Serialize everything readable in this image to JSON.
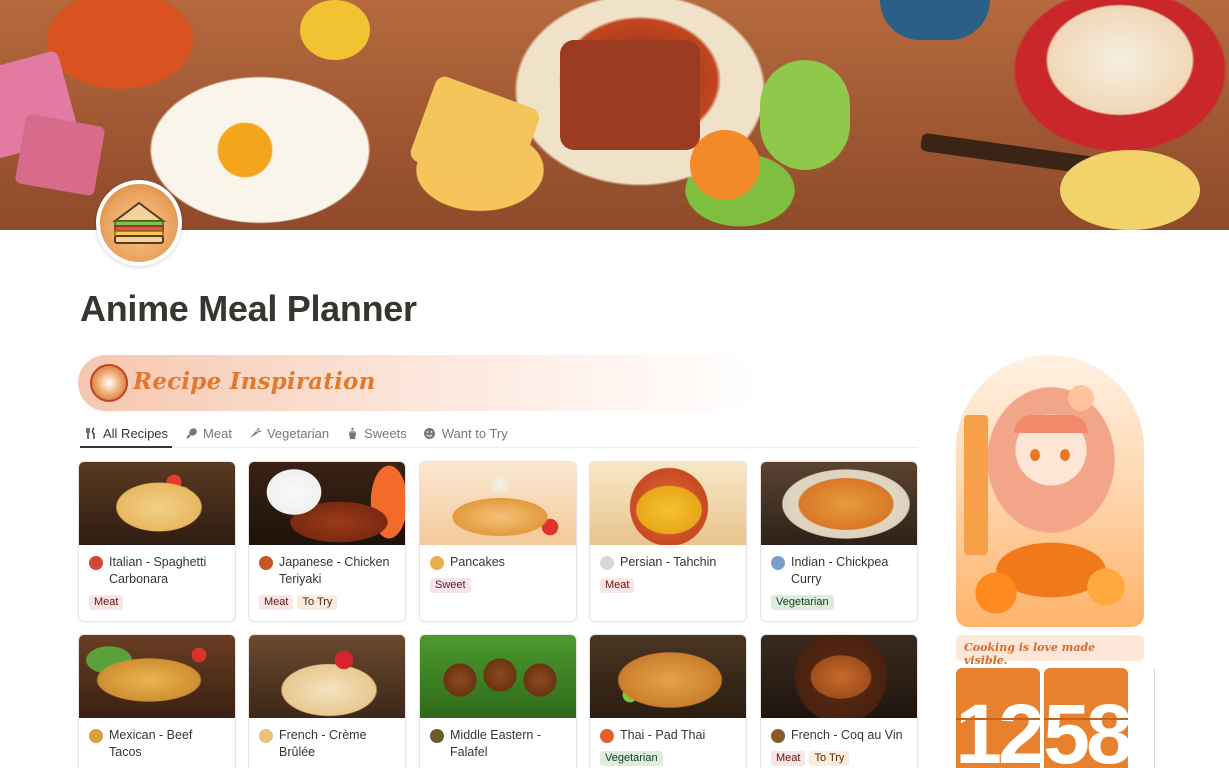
{
  "page": {
    "title": "Anime Meal Planner",
    "icon": "sandwich-icon"
  },
  "section": {
    "title": "Recipe Inspiration",
    "icon": "ramen-bowl-icon"
  },
  "tabs": [
    {
      "label": "All Recipes",
      "icon": "fork-knife-icon",
      "active": true
    },
    {
      "label": "Meat",
      "icon": "drumstick-icon",
      "active": false
    },
    {
      "label": "Vegetarian",
      "icon": "carrot-icon",
      "active": false
    },
    {
      "label": "Sweets",
      "icon": "cupcake-icon",
      "active": false
    },
    {
      "label": "Want to Try",
      "icon": "smile-icon",
      "active": false
    }
  ],
  "recipes": [
    {
      "title": "Italian - Spaghetti Carbonara",
      "emoji_color": "#d7443a",
      "tags": [
        {
          "label": "Meat",
          "type": "meat"
        }
      ]
    },
    {
      "title": "Japanese - Chicken Teriyaki",
      "emoji_color": "#c6562a",
      "tags": [
        {
          "label": "Meat",
          "type": "meat"
        },
        {
          "label": "To Try",
          "type": "try"
        }
      ]
    },
    {
      "title": "Pancakes",
      "emoji_color": "#e7b04c",
      "tags": [
        {
          "label": "Sweet",
          "type": "sweet"
        }
      ]
    },
    {
      "title": "Persian - Tahchin",
      "emoji_color": "#d7d7d7",
      "tags": [
        {
          "label": "Meat",
          "type": "meat"
        }
      ]
    },
    {
      "title": "Indian - Chickpea Curry",
      "emoji_color": "#7a9fc9",
      "tags": [
        {
          "label": "Vegetarian",
          "type": "veg"
        }
      ]
    },
    {
      "title": "Mexican - Beef Tacos",
      "emoji_color": "#d4a33a",
      "tags": []
    },
    {
      "title": "French - Crème Brûlée",
      "emoji_color": "#e9c27a",
      "tags": []
    },
    {
      "title": "Middle Eastern - Falafel",
      "emoji_color": "#6b5a2a",
      "tags": []
    },
    {
      "title": "Thai - Pad Thai",
      "emoji_color": "#e0602b",
      "tags": [
        {
          "label": "Vegetarian",
          "type": "veg"
        }
      ]
    },
    {
      "title": "French - Coq au Vin",
      "emoji_color": "#8a5a2a",
      "tags": [
        {
          "label": "Meat",
          "type": "meat"
        },
        {
          "label": "To Try",
          "type": "try"
        }
      ]
    }
  ],
  "sidebar": {
    "quote": "Cooking is love made visible.",
    "clock_hours": "12",
    "clock_minutes": "58"
  },
  "colors": {
    "accent_orange": "#e8812d",
    "section_title": "#e07a2c"
  }
}
